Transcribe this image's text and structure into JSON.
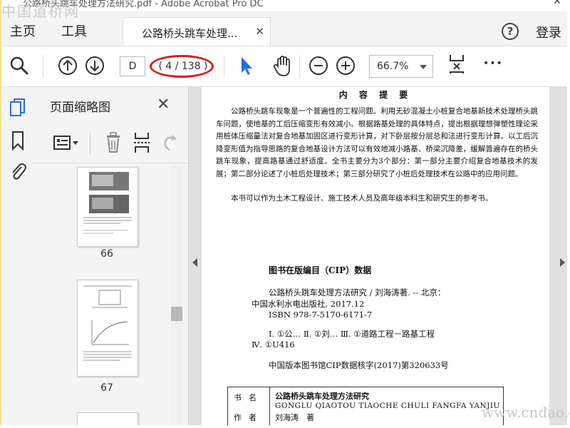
{
  "window": {
    "title": "公路桥头跳车处理方法研究.pdf - Adobe Acrobat Pro DC",
    "close_glyph": "✕"
  },
  "watermarks": {
    "top_left": "中国道桥网",
    "bottom_right": "www.cndao.com"
  },
  "menu": {
    "home": "主页",
    "tools": "工具",
    "tab_label": "公路桥头跳车处理...",
    "tab_close": "✕",
    "help_glyph": "?",
    "login": "登录"
  },
  "toolbar": {
    "page_input_value": "D",
    "page_count": "( 4 / 138 )",
    "zoom_value": "66.7%",
    "more_glyph": "•••"
  },
  "thumbnail_panel": {
    "title": "页面缩略图",
    "close_glyph": "✕",
    "pages": [
      "66",
      "67"
    ]
  },
  "document": {
    "heading": "内 容 提 要",
    "paragraph1": "公路桥头跳车现象是一个普遍性的工程问题。利用无砂混凝土小桩复合地基新技术处理桥头跳车问题，使地基的工后压缩变形有效减小。根据路基处理的具体特点，提出根据理想弹塑性理论采用桩体压缩量法对复合地基加固区进行变形计算，对下卧层按分层总和法进行变形计算。以工后沉降变形值为指导思路的复合地基设计方法可以有效地减小路基、桥梁沉降差，缓解普遍存在的桥头跳车现象，提高路基通过舒适度。全书主要分为3个部分：第一部分主要介绍复合地基技术的发展；第二部分论述了小桩后处理技术；第三部分研究了小桩后处理技术在公路中的应用问题。",
    "paragraph2": "本书可以作为土木工程设计、施工技术人员及高年级本科生和研究生的参考书。",
    "cip_title": "图书在版编目（CIP）数据",
    "cip_line1": "公路桥头跳车处理方法研究 / 刘海涛著. -- 北京：",
    "cip_line2": "中国水利水电出版社, 2017.12",
    "cip_line3": "ISBN 978-7-5170-6171-7",
    "cip_line4": "Ⅰ. ①公… Ⅱ. ①刘… Ⅲ. ①道路工程－路基工程",
    "cip_line5": "Ⅳ. ①U416",
    "cip_line6": "中国版本图书馆CIP数据核字(2017)第320633号",
    "table": {
      "row1_label": "书名",
      "row1_value": "公路桥头跳车处理方法研究",
      "row1_pinyin": "GONGLU QIAOTOU TIAOCHE CHULI FANGFA YANJIU",
      "row2_label": "作者",
      "row2_value": "刘海涛　著"
    }
  },
  "colors": {
    "select_arrow": "#2a6fd6",
    "annotation_oval": "#d61e1e",
    "frame_border": "#f2e08a"
  }
}
